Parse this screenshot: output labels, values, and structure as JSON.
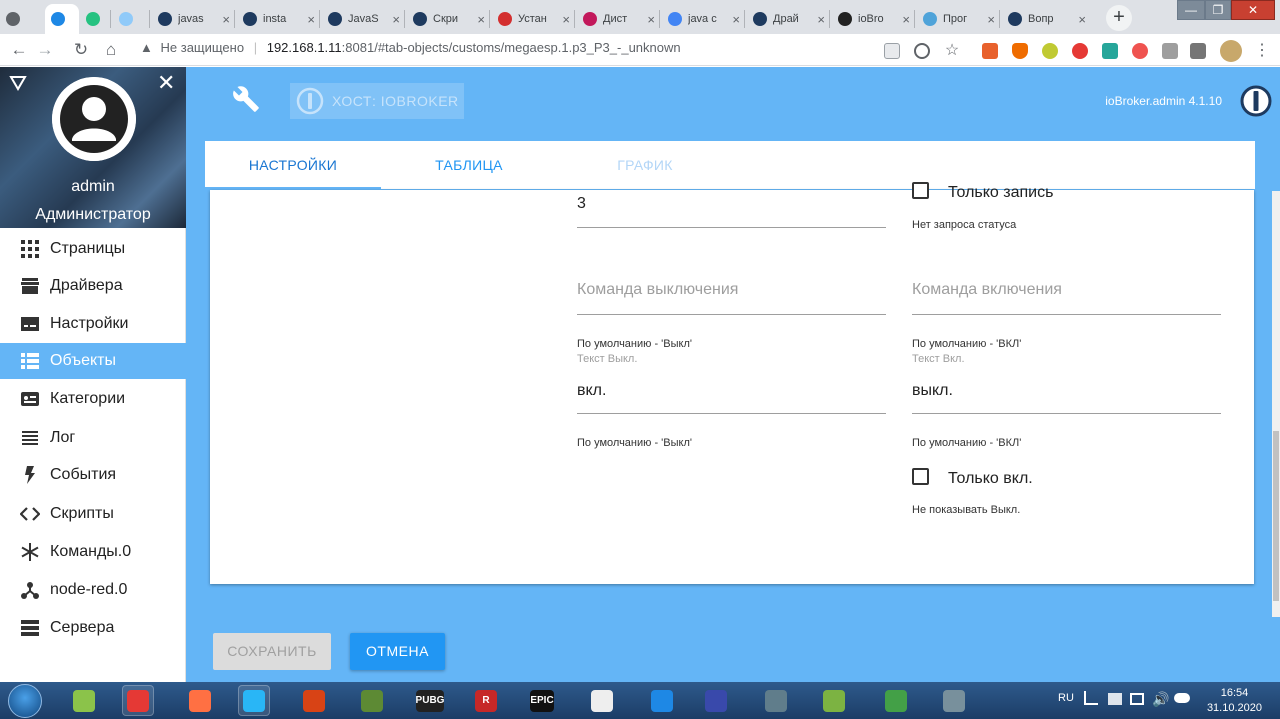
{
  "browser": {
    "tabs": [
      {
        "label": "",
        "color": "#5f6368"
      },
      {
        "label": "",
        "color": "#1e88e5"
      },
      {
        "label": "",
        "color": "#26c281"
      },
      {
        "label": "",
        "color": "#90caf9"
      },
      {
        "label": "javas",
        "color": "#1e3a5f"
      },
      {
        "label": "insta",
        "color": "#1e3a5f"
      },
      {
        "label": "JavaS",
        "color": "#1e3a5f"
      },
      {
        "label": "Скри",
        "color": "#1e3a5f"
      },
      {
        "label": "Устан",
        "color": "#d32f2f"
      },
      {
        "label": "Дист",
        "color": "#c2185b"
      },
      {
        "label": "java c",
        "color": "#4285f4"
      },
      {
        "label": "Драй",
        "color": "#1e3a5f"
      },
      {
        "label": "ioBro",
        "color": "#222222"
      },
      {
        "label": "Прог",
        "color": "#4fa3d9"
      },
      {
        "label": "Вопр",
        "color": "#1e3a5f"
      }
    ],
    "new_tab": "+",
    "window_controls": {
      "minimize": "—",
      "maximize": "❐",
      "close": "✕"
    },
    "back": "←",
    "forward": "→",
    "reload": "↻",
    "home": "⌂",
    "security_warning": "Не защищено",
    "url_host": "192.168.1.11",
    "url_path": ":8081/#tab-objects/customs/megaesp.1.p3_P3_-_unknown"
  },
  "header": {
    "host_label": "ХОСТ: IOBROKER",
    "version": "ioBroker.admin 4.1.10"
  },
  "sidebar": {
    "user_name": "admin",
    "user_role": "Администратор",
    "items": [
      {
        "label": "Страницы",
        "icon": "apps-icon"
      },
      {
        "label": "Драйвера",
        "icon": "store-icon"
      },
      {
        "label": "Настройки",
        "icon": "settings-icon"
      },
      {
        "label": "Объекты",
        "icon": "list-icon"
      },
      {
        "label": "Категории",
        "icon": "category-icon"
      },
      {
        "label": "Лог",
        "icon": "log-icon"
      },
      {
        "label": "События",
        "icon": "flash-icon"
      },
      {
        "label": "Скрипты",
        "icon": "code-icon"
      },
      {
        "label": "Команды.0",
        "icon": "snowflake-icon"
      },
      {
        "label": "node-red.0",
        "icon": "share-icon"
      },
      {
        "label": "Сервера",
        "icon": "server-icon"
      }
    ],
    "active_index": 3
  },
  "content_tabs": [
    {
      "label": "НАСТРОЙКИ",
      "state": "active"
    },
    {
      "label": "ТАБЛИЦА",
      "state": "normal"
    },
    {
      "label": "ГРАФИК",
      "state": "disabled"
    }
  ],
  "form": {
    "top_value": "3",
    "only_write_label": "Только запись",
    "no_status_hint": "Нет запроса статуса",
    "off_command_placeholder": "Команда выключения",
    "on_command_placeholder": "Команда включения",
    "off_default_hint": "По умолчанию - 'Выкл'",
    "on_default_hint": "По умолчанию - 'ВКЛ'",
    "off_text_label": "Текст Выкл.",
    "on_text_label": "Текст Вкл.",
    "off_text_value": "вкл.",
    "on_text_value": "выкл.",
    "off_text_hint": "По умолчанию - 'Выкл'",
    "on_text_hint": "По умолчанию - 'ВКЛ'",
    "only_on_label": "Только вкл.",
    "hide_off_hint": "Не показывать Выкл."
  },
  "footer": {
    "save_label": "СОХРАНИТЬ",
    "cancel_label": "ОТМЕНА"
  },
  "taskbar": {
    "apps": [
      "",
      "",
      "",
      "",
      "",
      "",
      "PUBG",
      "R",
      "EPIC",
      "",
      "",
      "",
      "",
      "",
      "",
      ""
    ],
    "language": "RU",
    "time": "16:54",
    "date": "31.10.2020"
  },
  "colors": {
    "accent": "#64b5f6",
    "primary_button": "#2196f3",
    "active_tab_text": "#1976d2"
  }
}
